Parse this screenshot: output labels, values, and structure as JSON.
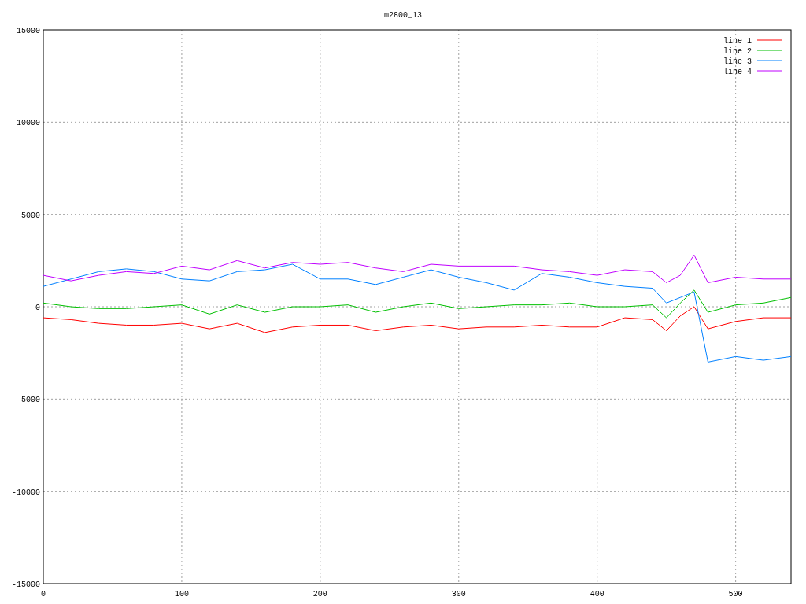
{
  "chart_data": {
    "type": "line",
    "title": "m2800_13",
    "x": [
      0,
      20,
      40,
      60,
      80,
      100,
      120,
      140,
      160,
      180,
      200,
      220,
      240,
      260,
      280,
      300,
      320,
      340,
      360,
      380,
      400,
      420,
      440,
      450,
      460,
      470,
      480,
      500,
      520,
      540
    ],
    "series": [
      {
        "name": "line 1",
        "color": "#ff0000",
        "values": [
          -600,
          -700,
          -900,
          -1000,
          -1000,
          -900,
          -1200,
          -900,
          -1400,
          -1100,
          -1000,
          -1000,
          -1300,
          -1100,
          -1000,
          -1200,
          -1100,
          -1100,
          -1000,
          -1100,
          -1100,
          -600,
          -700,
          -1300,
          -500,
          0,
          -1200,
          -800,
          -600,
          -600
        ]
      },
      {
        "name": "line 2",
        "color": "#00c000",
        "values": [
          200,
          0,
          -100,
          -100,
          0,
          100,
          -400,
          100,
          -300,
          0,
          0,
          100,
          -300,
          0,
          200,
          -100,
          0,
          100,
          100,
          200,
          0,
          0,
          100,
          -600,
          200,
          900,
          -300,
          100,
          200,
          500
        ]
      },
      {
        "name": "line 3",
        "color": "#0080ff",
        "values": [
          1100,
          1500,
          1900,
          2050,
          1900,
          1500,
          1400,
          1900,
          2000,
          2300,
          1500,
          1500,
          1200,
          1600,
          2000,
          1600,
          1300,
          900,
          1800,
          1600,
          1300,
          1100,
          1000,
          200,
          500,
          800,
          -3000,
          -2700,
          -2900,
          -2700
        ]
      },
      {
        "name": "line 4",
        "color": "#c000ff",
        "values": [
          1700,
          1400,
          1700,
          1900,
          1800,
          2200,
          2000,
          2500,
          2100,
          2400,
          2300,
          2400,
          2100,
          1900,
          2300,
          2200,
          2200,
          2200,
          2000,
          1900,
          1700,
          2000,
          1900,
          1300,
          1700,
          2800,
          1300,
          1600,
          1500,
          1500
        ]
      }
    ],
    "xlim": [
      0,
      540
    ],
    "ylim": [
      -15000,
      15000
    ],
    "xticks": [
      0,
      100,
      200,
      300,
      400,
      500
    ],
    "yticks": [
      -15000,
      -10000,
      -5000,
      0,
      5000,
      10000,
      15000
    ],
    "grid": true,
    "legend": true
  }
}
